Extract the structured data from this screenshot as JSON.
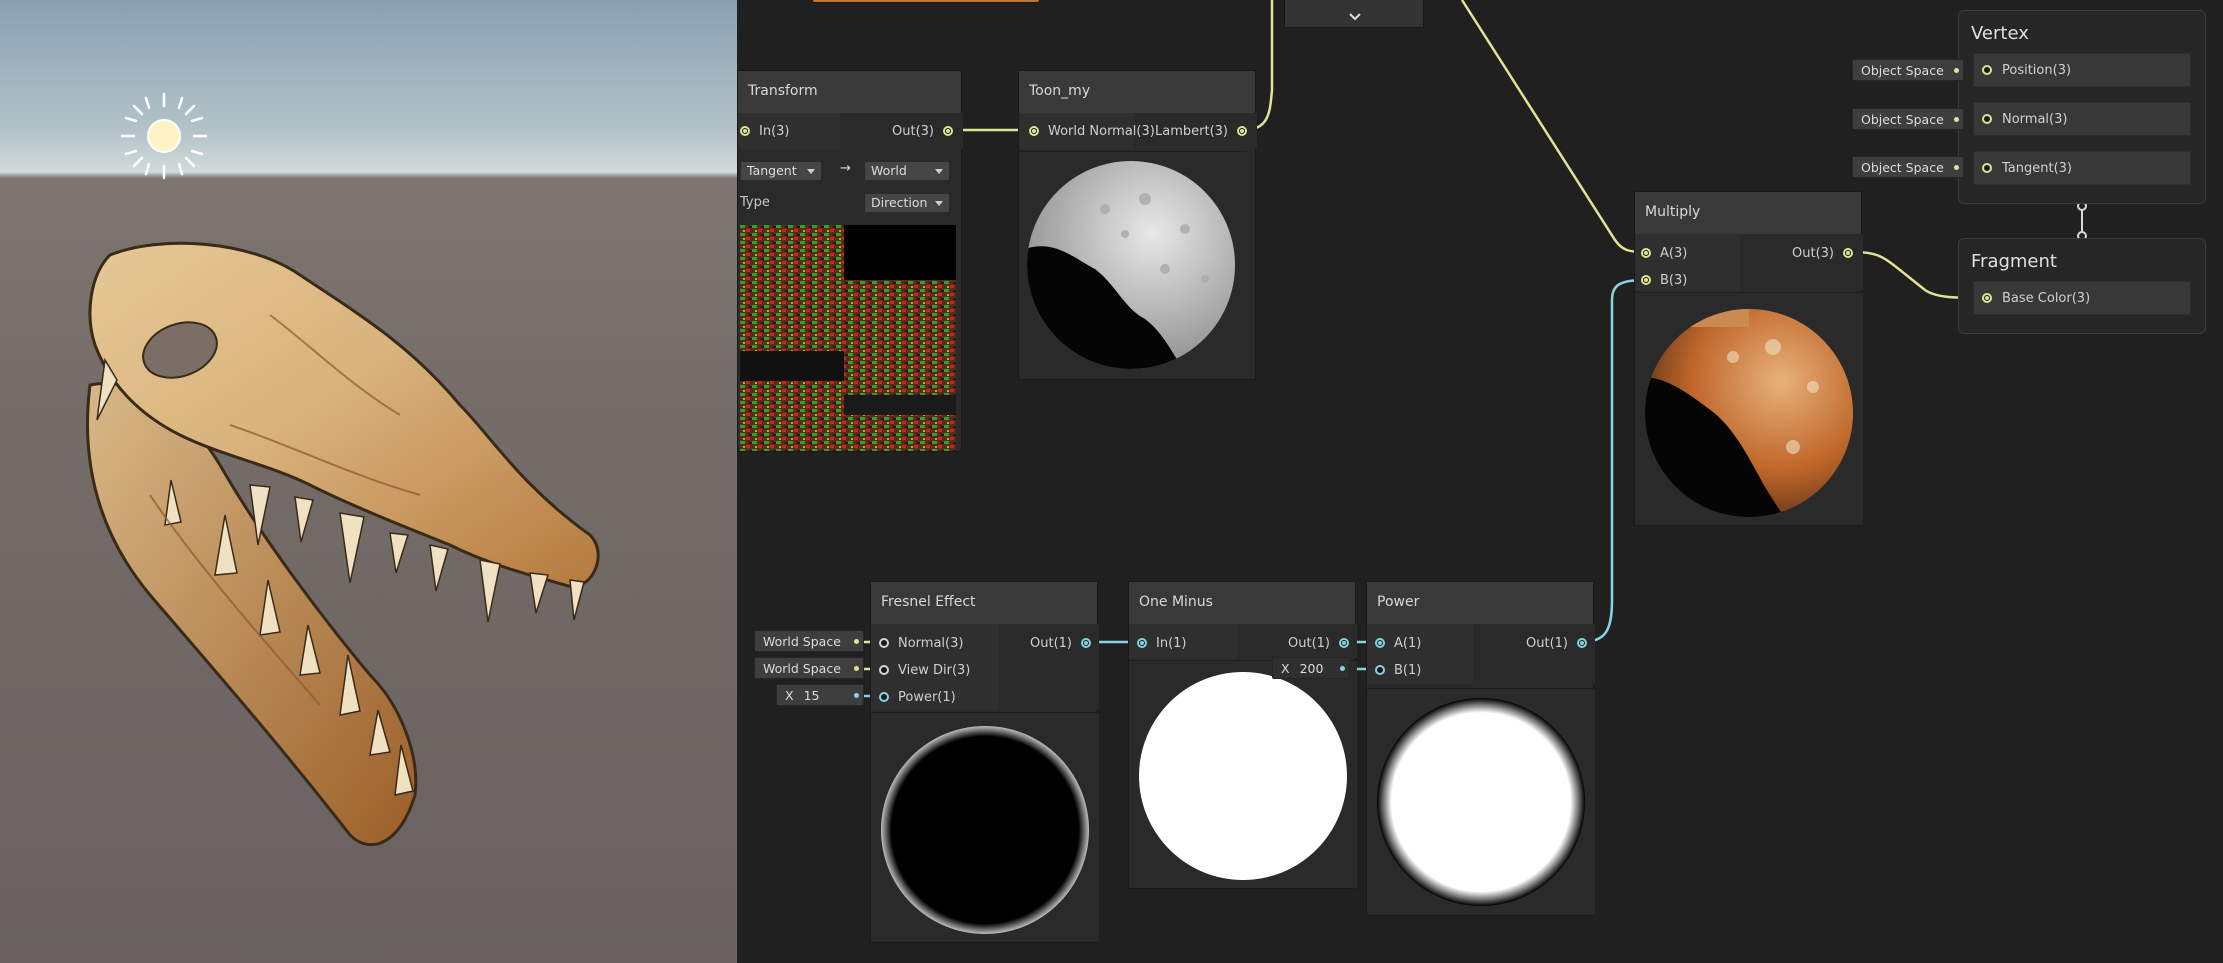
{
  "colors": {
    "vector_wire": "#e0e394",
    "float_wire": "#86d4e0",
    "node_body": "#2a2a2a",
    "node_header": "#393939",
    "graph_bg": "#202020"
  },
  "icons": {
    "sun": "sun-icon",
    "chevron": "chevron-down-icon"
  },
  "nodes": {
    "transform": {
      "title": "Transform",
      "in_port": "In(3)",
      "out_port": "Out(3)",
      "from_space": "Tangent",
      "arrow": "→",
      "to_space": "World",
      "type_label": "Type",
      "type_value": "Direction"
    },
    "toon": {
      "title": "Toon_my",
      "in_port": "World Normal(3)",
      "out_port": "Lambert(3)"
    },
    "multiply": {
      "title": "Multiply",
      "in_a": "A(3)",
      "in_b": "B(3)",
      "out_port": "Out(3)"
    },
    "fresnel": {
      "title": "Fresnel Effect",
      "in_normal": "Normal(3)",
      "in_viewdir": "View Dir(3)",
      "in_power": "Power(1)",
      "out_port": "Out(1)",
      "normal_space": "World Space",
      "viewdir_space": "World Space",
      "power_axis": "X",
      "power_value": "15"
    },
    "one_minus": {
      "title": "One Minus",
      "in_port": "In(1)",
      "out_port": "Out(1)"
    },
    "power": {
      "title": "Power",
      "in_a": "A(1)",
      "in_b": "B(1)",
      "out_port": "Out(1)",
      "b_axis": "X",
      "b_value": "200"
    }
  },
  "master": {
    "vertex": {
      "title": "Vertex",
      "fields": [
        "Position(3)",
        "Normal(3)",
        "Tangent(3)"
      ],
      "spaces": [
        "Object Space",
        "Object Space",
        "Object Space"
      ]
    },
    "fragment": {
      "title": "Fragment",
      "fields": [
        "Base Color(3)"
      ]
    }
  }
}
